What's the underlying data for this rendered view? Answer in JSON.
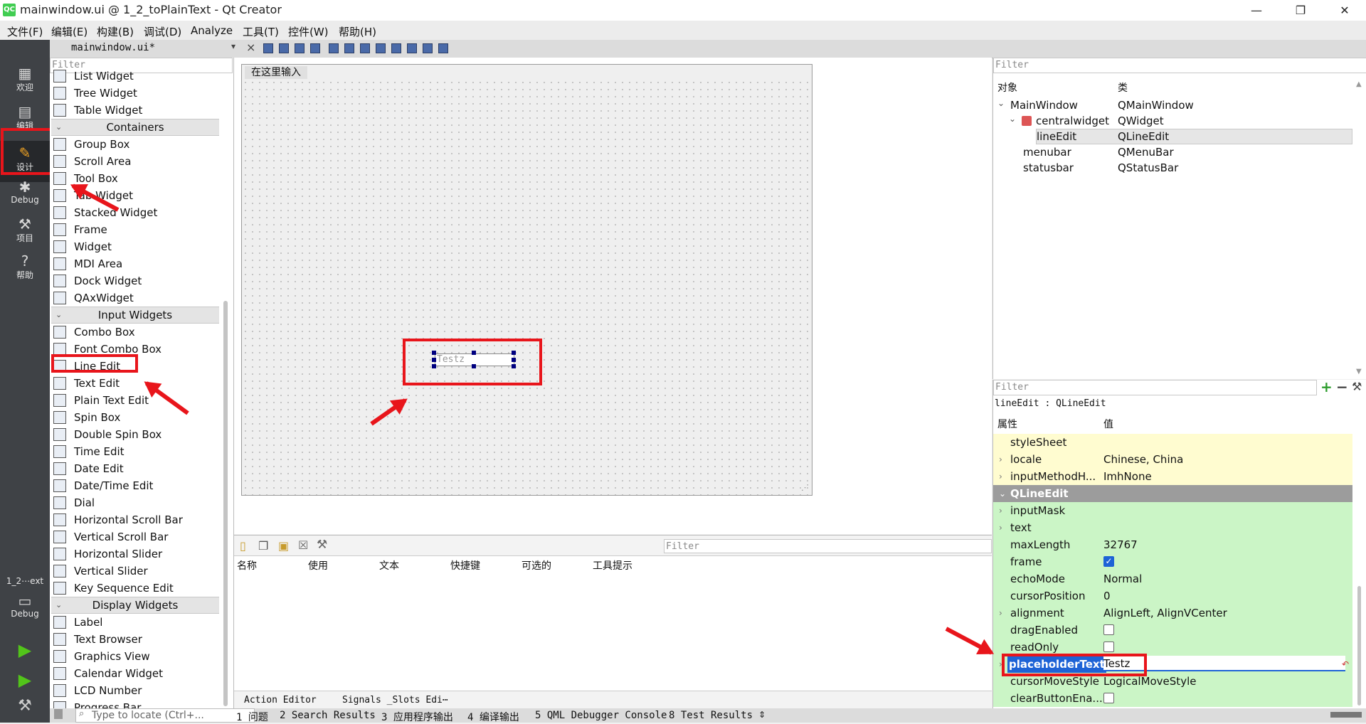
{
  "window": {
    "title": "mainwindow.ui @ 1_2_toPlainText - Qt Creator",
    "logo": "QC",
    "min": "—",
    "max": "❐",
    "close": "✕"
  },
  "menu": [
    "文件(F)",
    "编辑(E)",
    "构建(B)",
    "调试(D)",
    "Analyze",
    "工具(T)",
    "控件(W)",
    "帮助(H)"
  ],
  "modes": {
    "welcome": "欢迎",
    "edit": "编辑",
    "design": "设计",
    "debug": "Debug",
    "projects": "项目",
    "help": "帮助",
    "kit_label": "1_2⋯ext",
    "kit_mode": "Debug"
  },
  "editor_tab": {
    "file": "mainwindow.ui*"
  },
  "widget_box": {
    "filter_placeholder": "Filter",
    "top_items": [
      "List Widget",
      "Tree Widget",
      "Table Widget"
    ],
    "categories": {
      "containers": "Containers",
      "input": "Input Widgets",
      "display": "Display Widgets"
    },
    "containers": [
      "Group Box",
      "Scroll Area",
      "Tool Box",
      "Tab Widget",
      "Stacked Widget",
      "Frame",
      "Widget",
      "MDI Area",
      "Dock Widget",
      "QAxWidget"
    ],
    "input": [
      "Combo Box",
      "Font Combo Box",
      "Line Edit",
      "Text Edit",
      "Plain Text Edit",
      "Spin Box",
      "Double Spin Box",
      "Time Edit",
      "Date Edit",
      "Date/Time Edit",
      "Dial",
      "Horizontal Scroll Bar",
      "Vertical Scroll Bar",
      "Horizontal Slider",
      "Vertical Slider",
      "Key Sequence Edit"
    ],
    "display": [
      "Label",
      "Text Browser",
      "Graphics View",
      "Calendar Widget",
      "LCD Number",
      "Progress Bar"
    ]
  },
  "form": {
    "menu_placeholder": "在这里输入",
    "lineedit_placeholder": "Testz"
  },
  "action_editor": {
    "filter_placeholder": "Filter",
    "columns": [
      "名称",
      "使用",
      "文本",
      "快捷键",
      "可选的",
      "工具提示"
    ],
    "tabs": [
      "Action Editor",
      "Signals _Slots Edi⋯"
    ]
  },
  "object_inspector": {
    "filter_placeholder": "Filter",
    "col_object": "对象",
    "col_class": "类",
    "rows": [
      {
        "name": "MainWindow",
        "cls": "QMainWindow"
      },
      {
        "name": "centralwidget",
        "cls": "QWidget"
      },
      {
        "name": "lineEdit",
        "cls": "QLineEdit"
      },
      {
        "name": "menubar",
        "cls": "QMenuBar"
      },
      {
        "name": "statusbar",
        "cls": "QStatusBar"
      }
    ]
  },
  "property_editor": {
    "filter_placeholder": "Filter",
    "context": "lineEdit : QLineEdit",
    "col_prop": "属性",
    "col_value": "值",
    "rows_top": [
      {
        "name": "styleSheet",
        "value": ""
      },
      {
        "name": "locale",
        "value": "Chinese, China"
      },
      {
        "name": "inputMethodH...",
        "value": "ImhNone"
      }
    ],
    "section": "QLineEdit",
    "rows": [
      {
        "name": "inputMask",
        "value": ""
      },
      {
        "name": "text",
        "value": ""
      },
      {
        "name": "maxLength",
        "value": "32767"
      },
      {
        "name": "frame",
        "value": ""
      },
      {
        "name": "echoMode",
        "value": "Normal"
      },
      {
        "name": "cursorPosition",
        "value": "0"
      },
      {
        "name": "alignment",
        "value": "AlignLeft, AlignVCenter"
      },
      {
        "name": "dragEnabled",
        "value": ""
      },
      {
        "name": "readOnly",
        "value": ""
      },
      {
        "name": "placeholderText",
        "value": "Testz"
      },
      {
        "name": "cursorMoveStyle",
        "value": "LogicalMoveStyle"
      },
      {
        "name": "clearButtonEna...",
        "value": ""
      }
    ],
    "frame_checked": true,
    "dragEnabled_checked": false,
    "readOnly_checked": false,
    "clearButton_checked": false
  },
  "statusbar": {
    "locate_placeholder": "Type to locate (Ctrl+...",
    "panes": [
      "1 问题",
      "2 Search Results",
      "3 应用程序输出",
      "4 编译输出",
      "5 QML Debugger Console",
      "8 Test Results"
    ]
  },
  "colors": {
    "accent_red": "#e8151b",
    "prop_yellow": "#fffcd0",
    "prop_green": "#cbf5c6",
    "section_gray": "#9c9c9c",
    "selection_blue": "#1e63d6"
  }
}
